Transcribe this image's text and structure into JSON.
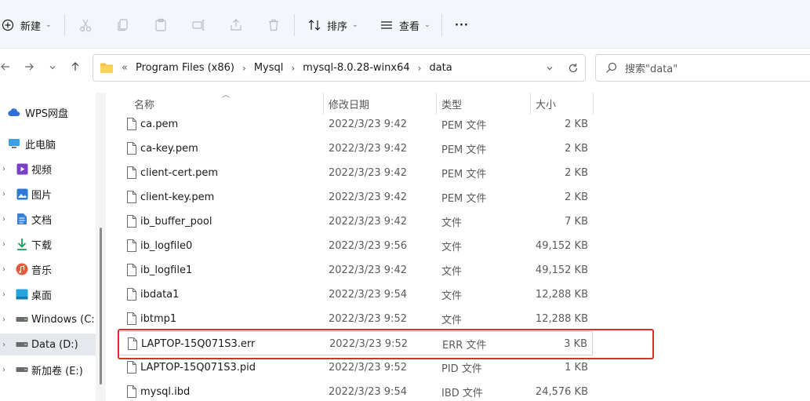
{
  "toolbar": {
    "new_label": "新建",
    "sort_label": "排序",
    "view_label": "查看",
    "more_label": "···"
  },
  "address": {
    "overflow": "«",
    "crumbs": [
      "Program Files (x86)",
      "Mysql",
      "mysql-8.0.28-winx64",
      "data"
    ],
    "separator": "›"
  },
  "search": {
    "placeholder": "搜索\"data\""
  },
  "sidebar": {
    "items": [
      {
        "label": "WPS网盘",
        "icon": "cloud-icon",
        "expander": ""
      },
      {
        "label": "此电脑",
        "icon": "computer-icon",
        "expander": ""
      },
      {
        "label": "视频",
        "icon": "video-folder-icon",
        "expander": "›"
      },
      {
        "label": "图片",
        "icon": "pictures-folder-icon",
        "expander": "›"
      },
      {
        "label": "文档",
        "icon": "documents-folder-icon",
        "expander": "›"
      },
      {
        "label": "下载",
        "icon": "download-icon",
        "expander": "›"
      },
      {
        "label": "音乐",
        "icon": "music-icon",
        "expander": "›"
      },
      {
        "label": "桌面",
        "icon": "desktop-folder-icon",
        "expander": "›"
      },
      {
        "label": "Windows (C:)",
        "icon": "drive-icon",
        "expander": "›"
      },
      {
        "label": "Data (D:)",
        "icon": "drive-icon",
        "expander": "›"
      },
      {
        "label": "新加卷 (E:)",
        "icon": "drive-icon",
        "expander": "›"
      }
    ],
    "selected_index": 9
  },
  "columns": {
    "name": "名称",
    "date": "修改日期",
    "type": "类型",
    "size": "大小"
  },
  "files": [
    {
      "name": "ca.pem",
      "date": "2022/3/23 9:42",
      "type": "PEM 文件",
      "size": "2 KB"
    },
    {
      "name": "ca-key.pem",
      "date": "2022/3/23 9:42",
      "type": "PEM 文件",
      "size": "2 KB"
    },
    {
      "name": "client-cert.pem",
      "date": "2022/3/23 9:42",
      "type": "PEM 文件",
      "size": "2 KB"
    },
    {
      "name": "client-key.pem",
      "date": "2022/3/23 9:42",
      "type": "PEM 文件",
      "size": "2 KB"
    },
    {
      "name": "ib_buffer_pool",
      "date": "2022/3/23 9:42",
      "type": "文件",
      "size": "7 KB"
    },
    {
      "name": "ib_logfile0",
      "date": "2022/3/23 9:56",
      "type": "文件",
      "size": "49,152 KB"
    },
    {
      "name": "ib_logfile1",
      "date": "2022/3/23 9:42",
      "type": "文件",
      "size": "49,152 KB"
    },
    {
      "name": "ibdata1",
      "date": "2022/3/23 9:54",
      "type": "文件",
      "size": "12,288 KB"
    },
    {
      "name": "ibtmp1",
      "date": "2022/3/23 9:52",
      "type": "文件",
      "size": "12,288 KB"
    },
    {
      "name": "LAPTOP-15Q071S3.err",
      "date": "2022/3/23 9:52",
      "type": "ERR 文件",
      "size": "3 KB"
    },
    {
      "name": "LAPTOP-15Q071S3.pid",
      "date": "2022/3/23 9:52",
      "type": "PID 文件",
      "size": "1 KB"
    },
    {
      "name": "mysql.ibd",
      "date": "2022/3/23 9:54",
      "type": "IBD 文件",
      "size": "24,576 KB"
    }
  ],
  "highlighted_index": 9,
  "colors": {
    "annotation_red": "#e02c2c",
    "selection_bg": "#e5e8ed",
    "toolbar_bg": "#f3f6fb"
  }
}
